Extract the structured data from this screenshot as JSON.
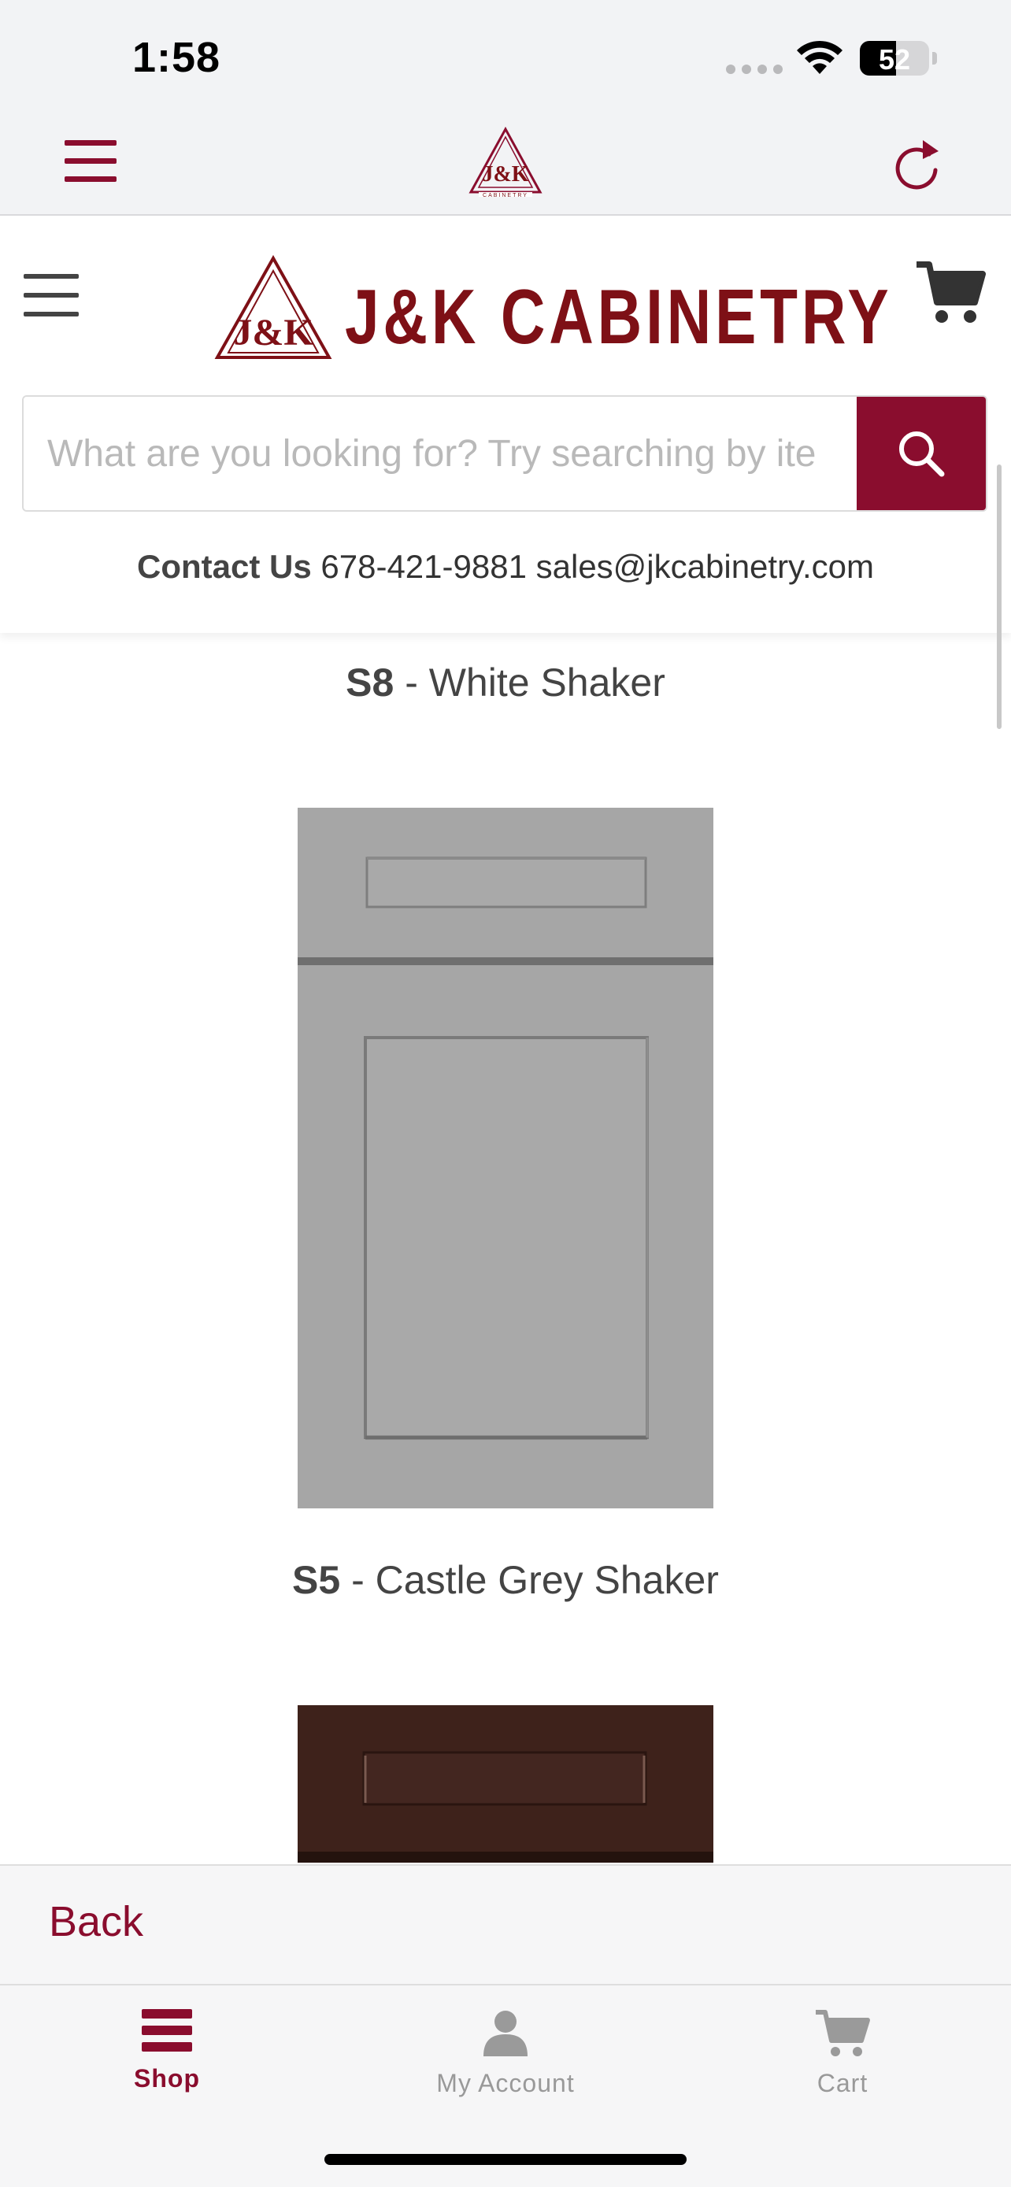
{
  "status_bar": {
    "time": "1:58",
    "battery_level": "52"
  },
  "app_nav": {
    "logo_alt": "J&K Cabinetry"
  },
  "header": {
    "brand_name": "J&K CABINETRY",
    "logo_mark": "J&K",
    "search": {
      "placeholder": "What are you looking for? Try searching by ite",
      "value": ""
    },
    "contact": {
      "label": "Contact Us",
      "phone": "678-421-9881",
      "email": "sales@jkcabinetry.com"
    }
  },
  "products": [
    {
      "code": "S8",
      "separator": " - ",
      "name": "White Shaker"
    },
    {
      "code": "S5",
      "separator": " - ",
      "name": "Castle Grey Shaker"
    }
  ],
  "back_bar": {
    "back_label": "Back"
  },
  "tab_bar": {
    "tabs": [
      {
        "label": "Shop",
        "icon": "menu-icon",
        "active": true
      },
      {
        "label": "My Account",
        "icon": "user-icon",
        "active": false
      },
      {
        "label": "Cart",
        "icon": "cart-icon",
        "active": false
      }
    ]
  },
  "colors": {
    "brand": "#8a0d2e",
    "brand_text": "#7e1016",
    "grey_door": "#a6a6a6",
    "espresso_door": "#3e221b"
  }
}
